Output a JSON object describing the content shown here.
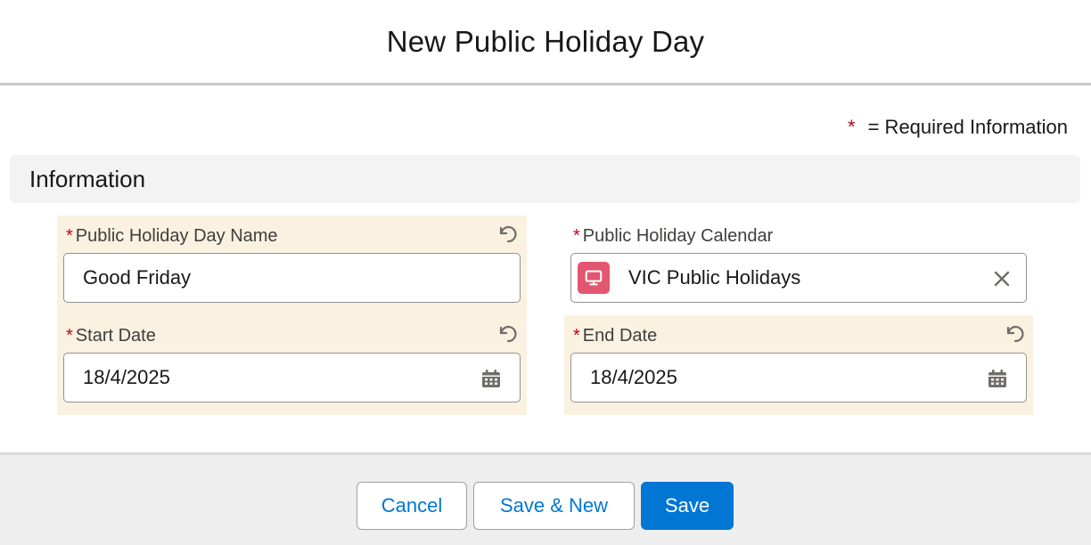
{
  "modal": {
    "title": "New Public Holiday Day"
  },
  "required_legend": {
    "asterisk": "*",
    "text": "= Required Information"
  },
  "section": {
    "title": "Information"
  },
  "fields": {
    "name": {
      "label": "Public Holiday Day Name",
      "required": "*",
      "value": "Good Friday"
    },
    "calendar": {
      "label": "Public Holiday Calendar",
      "required": "*",
      "value": "VIC Public Holidays",
      "icon": "monitor-icon",
      "icon_color": "#e3566f"
    },
    "start_date": {
      "label": "Start Date",
      "required": "*",
      "value": "18/4/2025"
    },
    "end_date": {
      "label": "End Date",
      "required": "*",
      "value": "18/4/2025"
    }
  },
  "footer": {
    "cancel_label": "Cancel",
    "save_new_label": "Save & New",
    "save_label": "Save"
  },
  "colors": {
    "brand": "#0176d3",
    "required": "#ba0517",
    "changed_highlight": "#fbf1e0"
  }
}
